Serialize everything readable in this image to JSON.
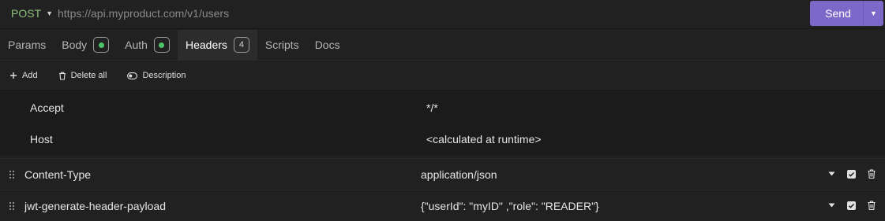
{
  "request": {
    "method": "POST",
    "url": "https://api.myproduct.com/v1/users",
    "send_label": "Send"
  },
  "tabs": [
    {
      "label": "Params"
    },
    {
      "label": "Body",
      "badge": "dot"
    },
    {
      "label": "Auth",
      "badge": "dot"
    },
    {
      "label": "Headers",
      "badge": "4",
      "active": true
    },
    {
      "label": "Scripts"
    },
    {
      "label": "Docs"
    }
  ],
  "toolbar": {
    "add": "Add",
    "delete_all": "Delete all",
    "description": "Description"
  },
  "headers": {
    "readonly": [
      {
        "name": "Accept",
        "value": "*/*"
      },
      {
        "name": "Host",
        "value": "<calculated at runtime>"
      }
    ],
    "custom": [
      {
        "name": "Content-Type",
        "value": "application/json"
      },
      {
        "name": "jwt-generate-header-payload",
        "value": "{\"userId\": \"myID\" ,\"role\": \"READER\"}"
      }
    ]
  },
  "colors": {
    "method": "#8ec07c",
    "send": "#7b68c8",
    "enabled_dot": "#4ec46a"
  }
}
